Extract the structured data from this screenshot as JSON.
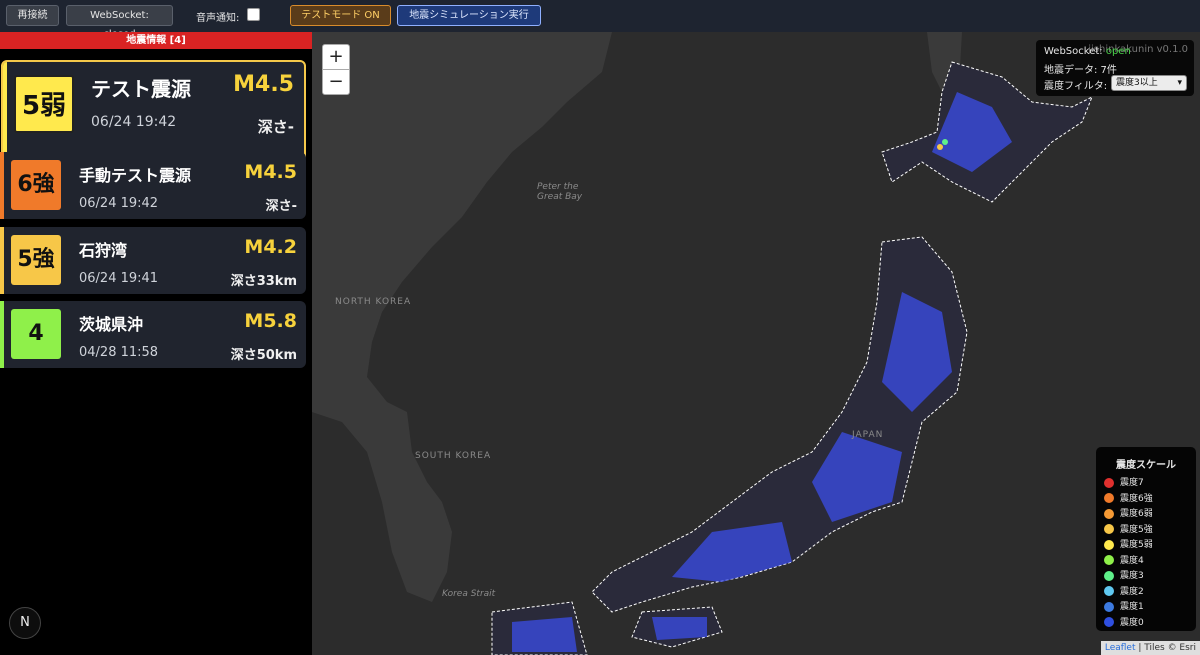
{
  "toolbar": {
    "reconnect_label": "再接続",
    "websocket_label": "WebSocket: closed",
    "sound_label": "音声通知:",
    "sound_checked": false,
    "test_mode_label": "テストモード ON",
    "simulate_label": "地震シミュレーション実行"
  },
  "sidebar": {
    "header": "地震情報 [4]",
    "cards": [
      {
        "intensity": "5弱",
        "place": "テスト震源",
        "magnitude": "M4.5",
        "time": "06/24 19:42",
        "depth": "深さ-",
        "color": "#ffe94d",
        "stripe": "#ffe94d"
      },
      {
        "intensity": "6強",
        "place": "手動テスト震源",
        "magnitude": "M4.5",
        "time": "06/24 19:42",
        "depth": "深さ-",
        "color": "#f07a2a",
        "stripe": "#f07a2a"
      },
      {
        "intensity": "5強",
        "place": "石狩湾",
        "magnitude": "M4.2",
        "time": "06/24 19:41",
        "depth": "深さ33km",
        "color": "#f7c748",
        "stripe": "#f7c748"
      },
      {
        "intensity": "4",
        "place": "茨城県沖",
        "magnitude": "M5.8",
        "time": "04/28 11:58",
        "depth": "深さ50km",
        "color": "#8ff04a",
        "stripe": "#8ff04a"
      }
    ],
    "compass_label": "N"
  },
  "map": {
    "zoom_in": "+",
    "zoom_out": "−",
    "labels": {
      "peter_bay": "Peter the Great Bay",
      "north_korea": "NORTH KOREA",
      "south_korea": "SOUTH KOREA",
      "korea_strait": "Korea Strait",
      "japan": "JAPAN"
    },
    "status": {
      "ws_prefix": "WebSocket: ",
      "ws_state": "open",
      "data_count": "地震データ: 7件",
      "filter_label": "震度フィルタ:",
      "filter_value": "震度3以上",
      "version": "jishinkakunin v0.1.0"
    },
    "legend": {
      "title": "震度スケール",
      "items": [
        {
          "label": "震度7",
          "color": "#e0302e"
        },
        {
          "label": "震度6強",
          "color": "#f07a2a"
        },
        {
          "label": "震度6弱",
          "color": "#f59a35"
        },
        {
          "label": "震度5強",
          "color": "#f7c748"
        },
        {
          "label": "震度5弱",
          "color": "#ffe94d"
        },
        {
          "label": "震度4",
          "color": "#8ff04a"
        },
        {
          "label": "震度3",
          "color": "#5ff08a"
        },
        {
          "label": "震度2",
          "color": "#5fc8f0"
        },
        {
          "label": "震度1",
          "color": "#3c7ae0"
        },
        {
          "label": "震度0",
          "color": "#2f4fe0"
        }
      ]
    },
    "attribution": {
      "leaflet": "Leaflet",
      "tiles": " | Tiles © Esri"
    }
  }
}
